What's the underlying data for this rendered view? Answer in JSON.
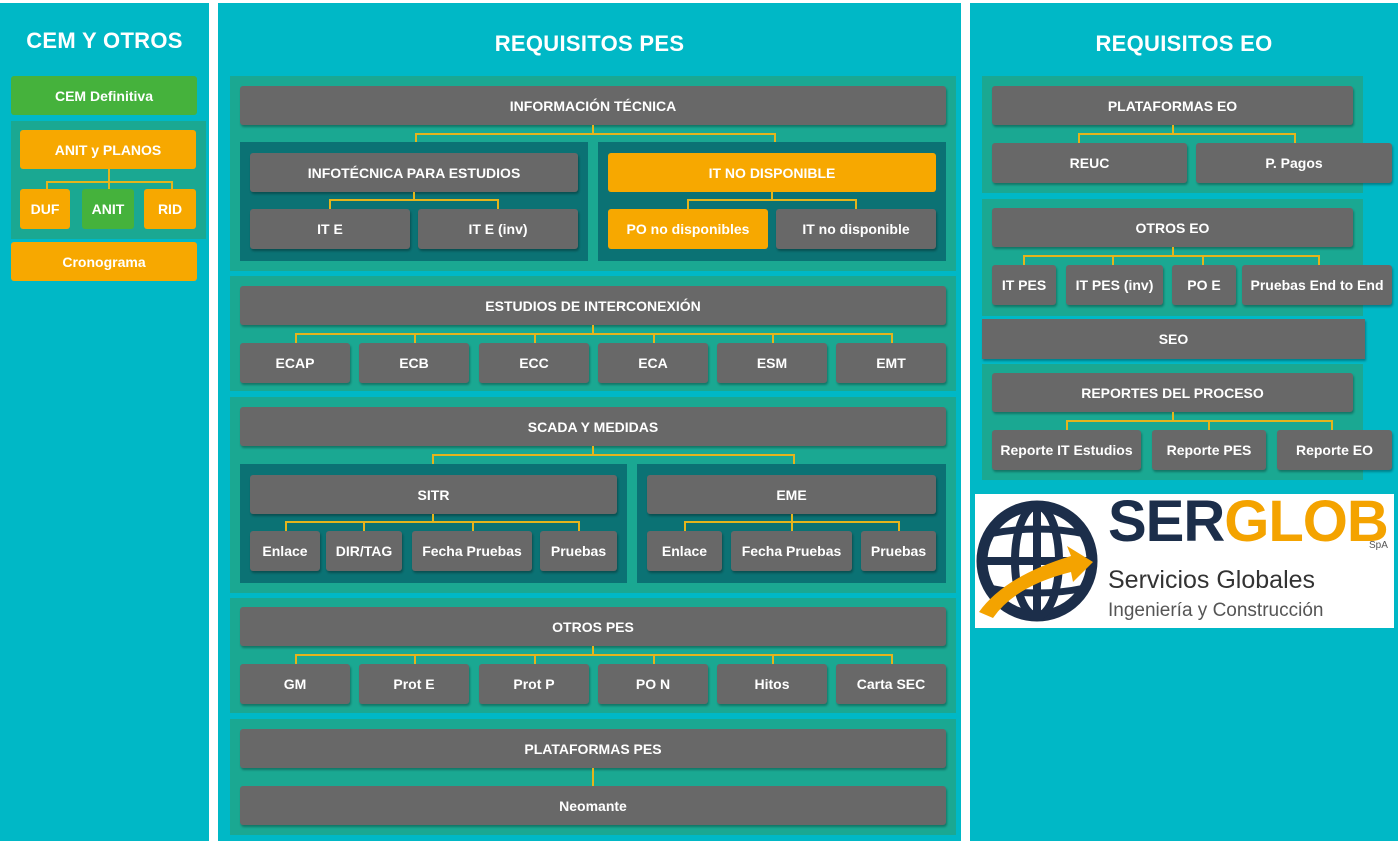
{
  "cem": {
    "title": "CEM Y OTROS",
    "cem_definitiva": "CEM Definitiva",
    "anit_planos": "ANIT y PLANOS",
    "duf": "DUF",
    "anit": "ANIT",
    "rid": "RID",
    "cronograma": "Cronograma"
  },
  "pes": {
    "title": "REQUISITOS PES",
    "info": {
      "title": "INFORMACIÓN TÉCNICA",
      "estudios": "INFOTÉCNICA PARA ESTUDIOS",
      "ite": "IT E",
      "ite_inv": "IT E (inv)",
      "nodisp": "IT NO DISPONIBLE",
      "po_nodisp": "PO no disponibles",
      "it_nodisp": "IT no disponible"
    },
    "estudios": {
      "title": "ESTUDIOS DE INTERCONEXIÓN",
      "items": [
        "ECAP",
        "ECB",
        "ECC",
        "ECA",
        "ESM",
        "EMT"
      ]
    },
    "scada": {
      "title": "SCADA Y MEDIDAS",
      "sitr": {
        "title": "SITR",
        "items": [
          "Enlace",
          "DIR/TAG",
          "Fecha Pruebas",
          "Pruebas"
        ]
      },
      "eme": {
        "title": "EME",
        "items": [
          "Enlace",
          "Fecha Pruebas",
          "Pruebas"
        ]
      }
    },
    "otros": {
      "title": "OTROS PES",
      "items": [
        "GM",
        "Prot E",
        "Prot P",
        "PO N",
        "Hitos",
        "Carta SEC"
      ]
    },
    "plataformas": {
      "title": "PLATAFORMAS PES",
      "item": "Neomante"
    }
  },
  "eo": {
    "title": "REQUISITOS EO",
    "plataformas": {
      "title": "PLATAFORMAS EO",
      "items": [
        "REUC",
        "P. Pagos"
      ]
    },
    "otros": {
      "title": "OTROS EO",
      "items": [
        "IT PES",
        "IT PES (inv)",
        "PO E",
        "Pruebas End to End"
      ]
    },
    "seo": "SEO",
    "reportes": {
      "title": "REPORTES DEL PROCESO",
      "items": [
        "Reporte IT Estudios",
        "Reporte PES",
        "Reporte EO"
      ]
    }
  },
  "logo": {
    "brand_dark": "SER",
    "brand_accent": "GLOB",
    "suffix": "SpA",
    "line1": "Servicios Globales",
    "line2": "Ingeniería y Construcción",
    "icon": "globe-arrow-icon",
    "colors": {
      "navy": "#1c2e4a",
      "orange": "#f4a300"
    }
  },
  "colors": {
    "teal_bg": "#00b8c6",
    "section": "#1aa892",
    "subsection": "#0b7274",
    "box_gray": "#686868",
    "box_orange": "#f7a800",
    "box_green": "#45b23c",
    "connector": "#e4b41c"
  }
}
